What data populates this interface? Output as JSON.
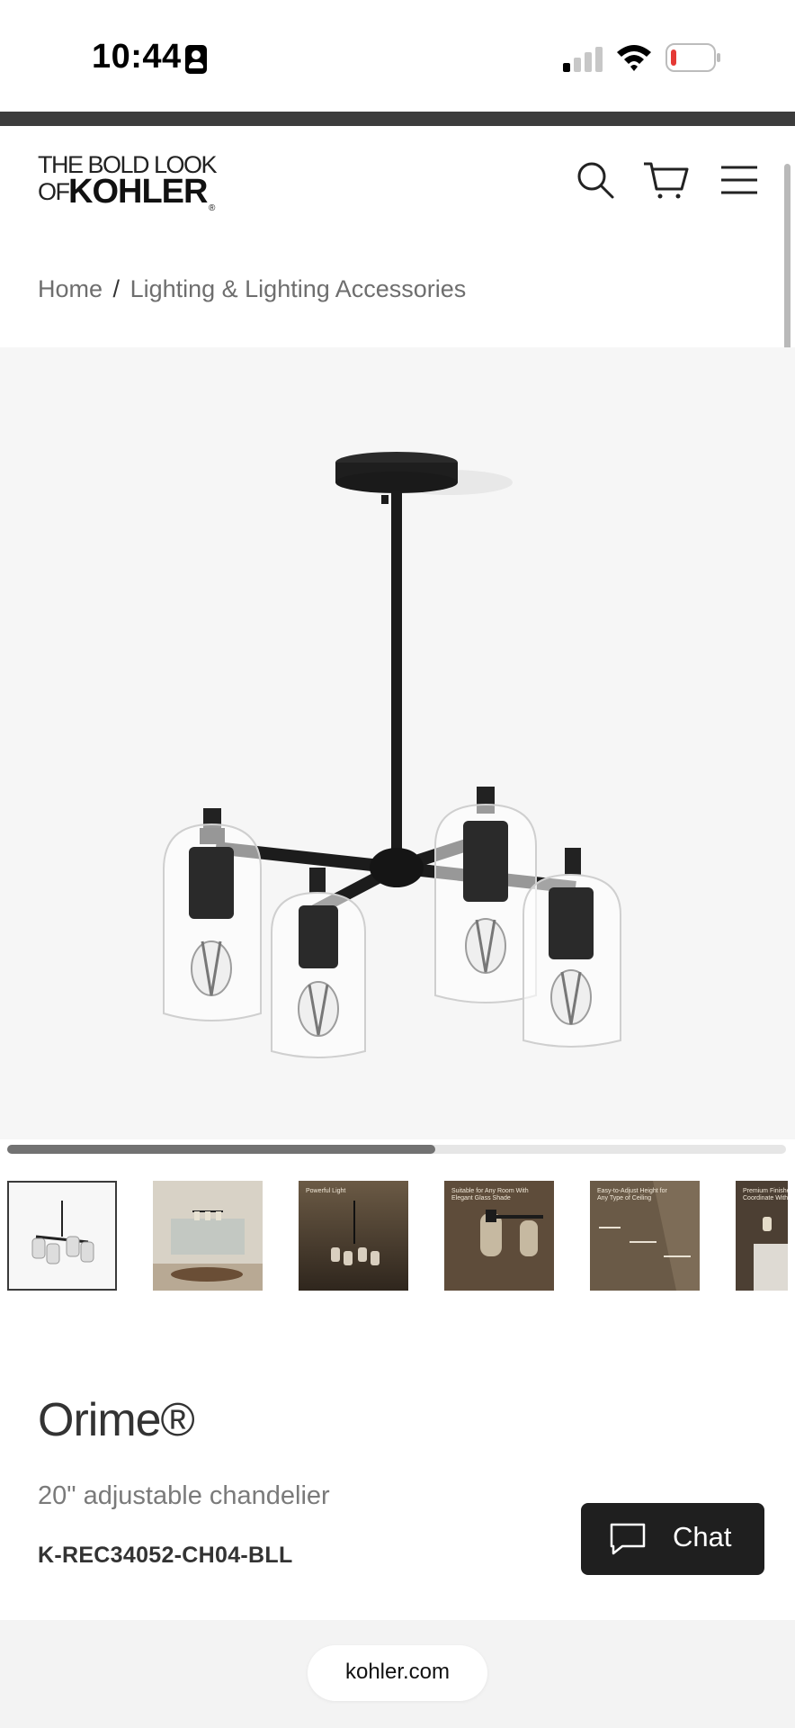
{
  "status_bar": {
    "time": "10:44",
    "battery_color": "#e53935"
  },
  "header": {
    "logo_line1": "THE BOLD LOOK",
    "logo_line2_prefix": "OF",
    "logo_brand": "KOHLER",
    "logo_reg": "®",
    "icons": [
      "search-icon",
      "cart-icon",
      "menu-icon"
    ]
  },
  "breadcrumb": {
    "items": [
      "Home",
      "Lighting & Lighting Accessories"
    ],
    "separator": "/"
  },
  "gallery": {
    "progress": 0.55,
    "thumbnails": [
      {
        "caption": ""
      },
      {
        "caption": ""
      },
      {
        "caption": "Powerful Light"
      },
      {
        "caption": "Suitable for Any Room With Elegant Glass Shade"
      },
      {
        "caption": "Easy-to-Adjust Height for Any Type of Ceiling"
      },
      {
        "caption": "Premium Finishes Coordinate With K..."
      }
    ]
  },
  "product": {
    "name": "Orime®",
    "description": "20\" adjustable chandelier",
    "sku": "K-REC34052-CH04-BLL"
  },
  "chat": {
    "label": "Chat"
  },
  "browser": {
    "url": "kohler.com"
  }
}
